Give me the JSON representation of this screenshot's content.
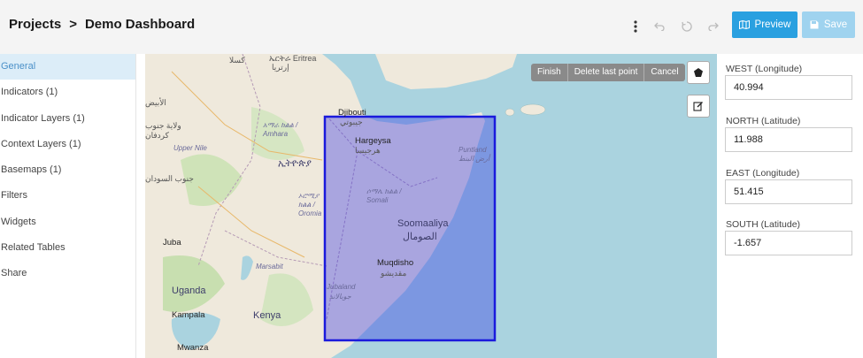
{
  "breadcrumb": {
    "root": "Projects",
    "separator": ">",
    "current": "Demo Dashboard"
  },
  "toolbar": {
    "preview_label": "Preview",
    "save_label": "Save"
  },
  "sidebar": {
    "items": [
      {
        "label": "General",
        "active": true
      },
      {
        "label": "Indicators (1)"
      },
      {
        "label": "Indicator Layers (1)"
      },
      {
        "label": "Context Layers (1)"
      },
      {
        "label": "Basemaps (1)"
      },
      {
        "label": "Filters"
      },
      {
        "label": "Widgets"
      },
      {
        "label": "Related Tables"
      },
      {
        "label": "Share"
      }
    ]
  },
  "draw_toolbar": {
    "finish": "Finish",
    "delete_last": "Delete last point",
    "cancel": "Cancel"
  },
  "map": {
    "labels": {
      "eritrea": "ኤርትራ Eritrea",
      "eritrea_ar": "إرتريا",
      "djibouti": "Djibouti",
      "djibouti_ar": "جيبوتي",
      "hargeysa": "Hargeysa",
      "hargeysa_ar": "هرجيسا",
      "puntland": "Puntland",
      "puntland_ar": "أرض البنط",
      "somali_region": "ሶማሌ ክልል / Somali",
      "somaaliya": "Soomaaliya",
      "somaaliya_ar": "الصومال",
      "muqdisho": "Muqdisho",
      "muqdisho_ar": "مقديشو",
      "jubaland": "Jubaland",
      "jubaland_ar": "جوبالاند",
      "amhara": "አማራ ክልል / Amhara",
      "ethiopia": "ኢትዮጵያ",
      "oromia": "ኦሮሚያ ክልል / Oromia",
      "upper_nile": "Upper Nile",
      "juba": "Juba",
      "marsabit": "Marsabit",
      "uganda": "Uganda",
      "kampala": "Kampala",
      "kenya": "Kenya",
      "mwanza": "Mwanza",
      "kassala": "كسلا",
      "sudan_state": "ولاية جنوب كردفان",
      "south_sudan": "جنوب السودان",
      "abyei": "الأبيض"
    },
    "selection_color": "#1a1adc"
  },
  "bounds": {
    "west_label": "WEST (Longitude)",
    "west": "40.994",
    "north_label": "NORTH (Latitude)",
    "north": "11.988",
    "east_label": "EAST (Longitude)",
    "east": "51.415",
    "south_label": "SOUTH (Latitude)",
    "south": "-1.657"
  }
}
